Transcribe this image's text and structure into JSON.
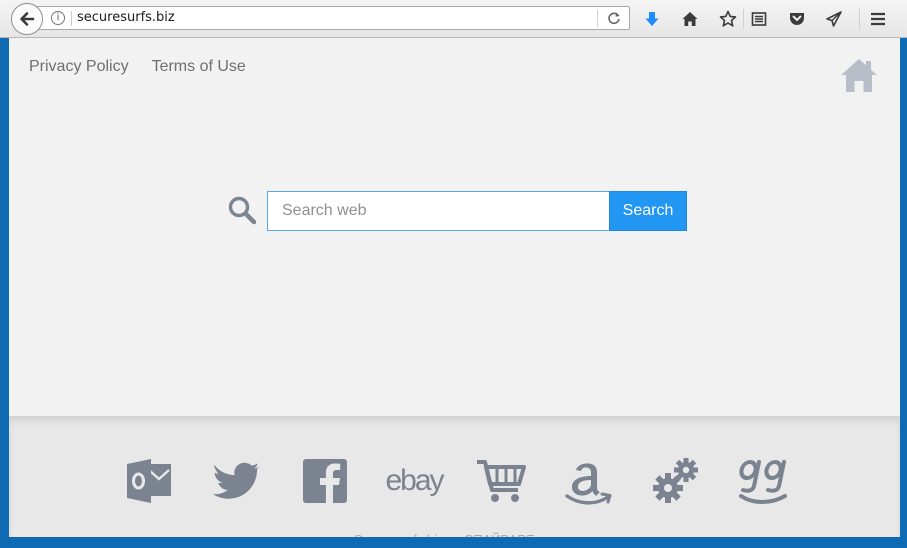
{
  "browser": {
    "url": "securesurfs.biz",
    "icons": [
      "back-arrow-icon",
      "info-icon",
      "reload-icon",
      "download-icon",
      "home-icon",
      "star-icon",
      "reading-list-icon",
      "pocket-icon",
      "send-icon",
      "menu-icon"
    ]
  },
  "page": {
    "links": [
      {
        "label": "Privacy Policy"
      },
      {
        "label": "Terms of Use"
      }
    ],
    "search": {
      "placeholder": "Search web",
      "button_label": "Search"
    }
  },
  "footer": {
    "shortcuts": [
      {
        "name": "outlook",
        "icon": "outlook-icon"
      },
      {
        "name": "twitter",
        "icon": "twitter-icon"
      },
      {
        "name": "facebook",
        "icon": "facebook-icon"
      },
      {
        "name": "ebay",
        "label": "ebay"
      },
      {
        "name": "shopping",
        "icon": "cart-icon"
      },
      {
        "name": "amazon",
        "icon": "amazon-icon"
      },
      {
        "name": "settings",
        "icon": "gears-icon"
      },
      {
        "name": "google",
        "icon": "google-icon"
      }
    ],
    "credit": "Securesurfs.biz — СПАЙВАРЕ.ru"
  },
  "colors": {
    "accent": "#2196f3",
    "icon_gray": "#7b8390",
    "desktop": "#0f6ab4"
  }
}
